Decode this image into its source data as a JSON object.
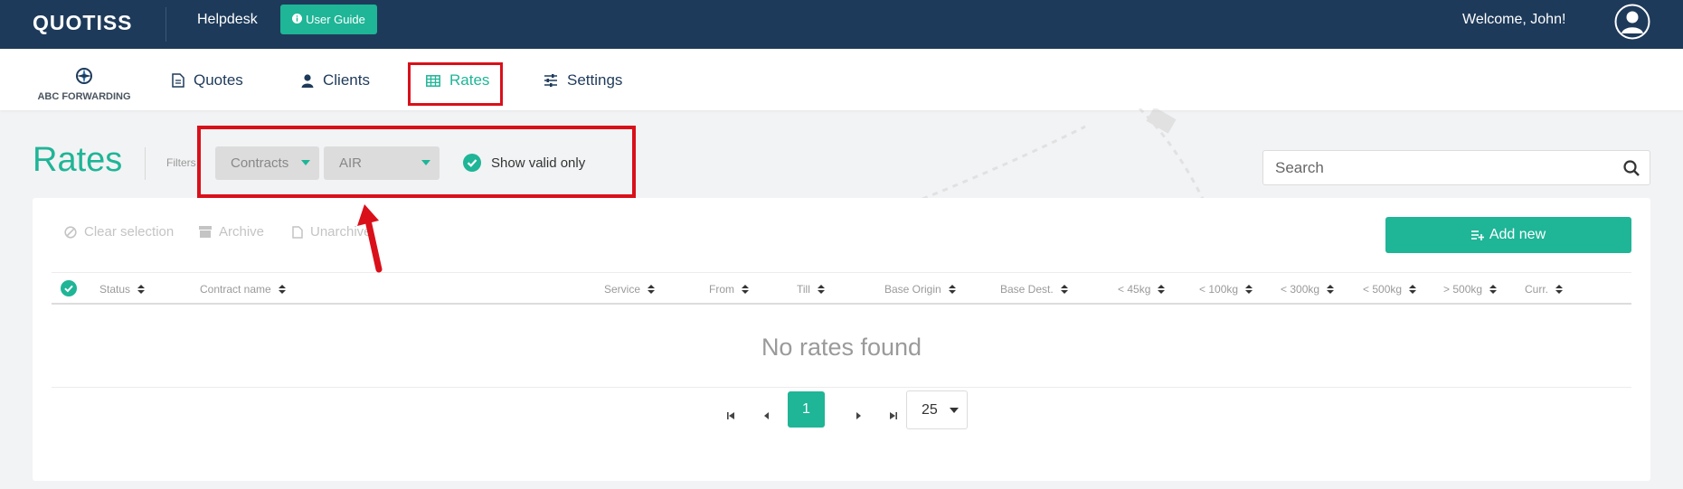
{
  "topbar": {
    "logo": "QUOTISS",
    "helpdesk": "Helpdesk",
    "user_guide": "User Guide",
    "welcome": "Welcome, John!"
  },
  "nav": {
    "brand": "ABC FORWARDING",
    "items": [
      {
        "label": "Quotes",
        "icon": "document-icon"
      },
      {
        "label": "Clients",
        "icon": "user-icon"
      },
      {
        "label": "Rates",
        "icon": "table-icon",
        "active": true
      },
      {
        "label": "Settings",
        "icon": "sliders-icon"
      }
    ]
  },
  "page": {
    "title": "Rates",
    "filters_label": "Filters",
    "filter_type": "Contracts",
    "filter_mode": "AIR",
    "show_valid_only": "Show valid only",
    "search_placeholder": "Search"
  },
  "toolbar": {
    "clear_selection": "Clear selection",
    "archive": "Archive",
    "unarchive": "Unarchive",
    "add_new": "Add new"
  },
  "table": {
    "columns": [
      "Status",
      "Contract name",
      "Service",
      "From",
      "Till",
      "Base Origin",
      "Base Dest.",
      "< 45kg",
      "< 100kg",
      "< 300kg",
      "< 500kg",
      "> 500kg",
      "Curr."
    ],
    "empty_text": "No rates found"
  },
  "pagination": {
    "current_page": "1",
    "page_size": "25"
  },
  "colors": {
    "accent": "#1fb597",
    "topbar": "#1e3a5a",
    "highlight": "#d9101a"
  }
}
